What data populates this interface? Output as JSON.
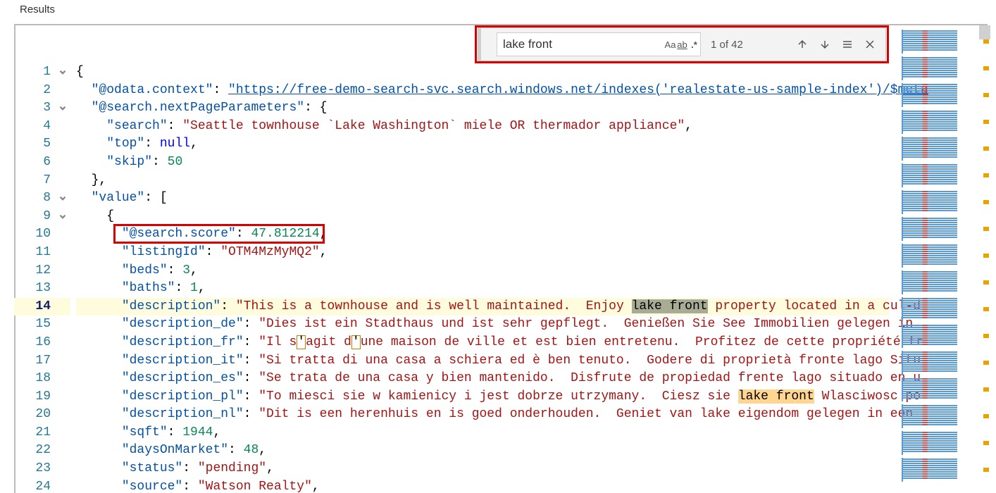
{
  "header": {
    "results_label": "Results"
  },
  "find": {
    "value": "lake front",
    "opt_case": "Aa",
    "opt_word": "ab",
    "opt_regex": ".*",
    "count": "1 of 42"
  },
  "lines": [
    {
      "n": 1,
      "fold": true,
      "indent": 0,
      "segs": [
        {
          "t": "punc",
          "v": "{"
        }
      ]
    },
    {
      "n": 2,
      "indent": 1,
      "segs": [
        {
          "t": "key",
          "v": "\"@odata.context\""
        },
        {
          "t": "punc",
          "v": ": "
        },
        {
          "t": "link",
          "v": "\"https://free-demo-search-svc.search.windows.net/indexes('realestate-us-sample-index')/$meta"
        }
      ]
    },
    {
      "n": 3,
      "fold": true,
      "indent": 1,
      "segs": [
        {
          "t": "key",
          "v": "\"@search.nextPageParameters\""
        },
        {
          "t": "punc",
          "v": ": {"
        }
      ]
    },
    {
      "n": 4,
      "indent": 2,
      "segs": [
        {
          "t": "key",
          "v": "\"search\""
        },
        {
          "t": "punc",
          "v": ": "
        },
        {
          "t": "str",
          "v": "\"Seattle townhouse `Lake Washington` miele OR thermador appliance\""
        },
        {
          "t": "punc",
          "v": ","
        }
      ]
    },
    {
      "n": 5,
      "indent": 2,
      "segs": [
        {
          "t": "key",
          "v": "\"top\""
        },
        {
          "t": "punc",
          "v": ": "
        },
        {
          "t": "null",
          "v": "null"
        },
        {
          "t": "punc",
          "v": ","
        }
      ]
    },
    {
      "n": 6,
      "indent": 2,
      "segs": [
        {
          "t": "key",
          "v": "\"skip\""
        },
        {
          "t": "punc",
          "v": ": "
        },
        {
          "t": "num",
          "v": "50"
        }
      ]
    },
    {
      "n": 7,
      "indent": 1,
      "segs": [
        {
          "t": "punc",
          "v": "},"
        }
      ]
    },
    {
      "n": 8,
      "fold": true,
      "indent": 1,
      "segs": [
        {
          "t": "key",
          "v": "\"value\""
        },
        {
          "t": "punc",
          "v": ": ["
        }
      ]
    },
    {
      "n": 9,
      "fold": true,
      "indent": 2,
      "segs": [
        {
          "t": "punc",
          "v": "{"
        }
      ]
    },
    {
      "n": 10,
      "indent": 3,
      "annot": true,
      "segs": [
        {
          "t": "key",
          "v": "\"@search.score\""
        },
        {
          "t": "punc",
          "v": ": "
        },
        {
          "t": "num",
          "v": "47.812214"
        },
        {
          "t": "punc",
          "v": ","
        }
      ]
    },
    {
      "n": 11,
      "indent": 3,
      "segs": [
        {
          "t": "key",
          "v": "\"listingId\""
        },
        {
          "t": "punc",
          "v": ": "
        },
        {
          "t": "str",
          "v": "\"OTM4MzMyMQ2\""
        },
        {
          "t": "punc",
          "v": ","
        }
      ]
    },
    {
      "n": 12,
      "indent": 3,
      "segs": [
        {
          "t": "key",
          "v": "\"beds\""
        },
        {
          "t": "punc",
          "v": ": "
        },
        {
          "t": "num",
          "v": "3"
        },
        {
          "t": "punc",
          "v": ","
        }
      ]
    },
    {
      "n": 13,
      "indent": 3,
      "segs": [
        {
          "t": "key",
          "v": "\"baths\""
        },
        {
          "t": "punc",
          "v": ": "
        },
        {
          "t": "num",
          "v": "1"
        },
        {
          "t": "punc",
          "v": ","
        }
      ]
    },
    {
      "n": 14,
      "current": true,
      "indent": 3,
      "segs": [
        {
          "t": "key",
          "v": "\"description\""
        },
        {
          "t": "punc",
          "v": ": "
        },
        {
          "t": "str",
          "v": "\"This is a townhouse and is well maintained.  Enjoy "
        },
        {
          "t": "match-sel",
          "v": "lake front"
        },
        {
          "t": "str",
          "v": " property located in a cul-d"
        }
      ]
    },
    {
      "n": 15,
      "indent": 3,
      "segs": [
        {
          "t": "key",
          "v": "\"description_de\""
        },
        {
          "t": "punc",
          "v": ": "
        },
        {
          "t": "str",
          "v": "\"Dies ist ein Stadthaus und ist sehr gepflegt.  Genießen Sie See Immobilien gelegen in "
        }
      ]
    },
    {
      "n": 16,
      "indent": 3,
      "segs": [
        {
          "t": "key",
          "v": "\"description_fr\""
        },
        {
          "t": "punc",
          "v": ": "
        },
        {
          "t": "str",
          "v": "\"Il s"
        },
        {
          "t": "char-hl",
          "v": "'"
        },
        {
          "t": "str",
          "v": "agit d"
        },
        {
          "t": "char-hl",
          "v": "'"
        },
        {
          "t": "str",
          "v": "une maison de ville et est bien entretenu.  Profitez de cette propriété fr"
        }
      ]
    },
    {
      "n": 17,
      "indent": 3,
      "segs": [
        {
          "t": "key",
          "v": "\"description_it\""
        },
        {
          "t": "punc",
          "v": ": "
        },
        {
          "t": "str",
          "v": "\"Si tratta di una casa a schiera ed è ben tenuto.  Godere di proprietà fronte lago Situ"
        }
      ]
    },
    {
      "n": 18,
      "indent": 3,
      "segs": [
        {
          "t": "key",
          "v": "\"description_es\""
        },
        {
          "t": "punc",
          "v": ": "
        },
        {
          "t": "str",
          "v": "\"Se trata de una casa y bien mantenido.  Disfrute de propiedad frente lago situado en u"
        }
      ]
    },
    {
      "n": 19,
      "indent": 3,
      "segs": [
        {
          "t": "key",
          "v": "\"description_pl\""
        },
        {
          "t": "punc",
          "v": ": "
        },
        {
          "t": "str",
          "v": "\"To miesci sie w kamienicy i jest dobrze utrzymany.  Ciesz sie "
        },
        {
          "t": "match-hl",
          "v": "lake front"
        },
        {
          "t": "str",
          "v": " Wlasciwosc po"
        }
      ]
    },
    {
      "n": 20,
      "indent": 3,
      "segs": [
        {
          "t": "key",
          "v": "\"description_nl\""
        },
        {
          "t": "punc",
          "v": ": "
        },
        {
          "t": "str",
          "v": "\"Dit is een herenhuis en is goed onderhouden.  Geniet van lake eigendom gelegen in een "
        }
      ]
    },
    {
      "n": 21,
      "indent": 3,
      "segs": [
        {
          "t": "key",
          "v": "\"sqft\""
        },
        {
          "t": "punc",
          "v": ": "
        },
        {
          "t": "num",
          "v": "1944"
        },
        {
          "t": "punc",
          "v": ","
        }
      ]
    },
    {
      "n": 22,
      "indent": 3,
      "segs": [
        {
          "t": "key",
          "v": "\"daysOnMarket\""
        },
        {
          "t": "punc",
          "v": ": "
        },
        {
          "t": "num",
          "v": "48"
        },
        {
          "t": "punc",
          "v": ","
        }
      ]
    },
    {
      "n": 23,
      "indent": 3,
      "segs": [
        {
          "t": "key",
          "v": "\"status\""
        },
        {
          "t": "punc",
          "v": ": "
        },
        {
          "t": "str",
          "v": "\"pending\""
        },
        {
          "t": "punc",
          "v": ","
        }
      ]
    },
    {
      "n": 24,
      "indent": 3,
      "segs": [
        {
          "t": "key",
          "v": "\"source\""
        },
        {
          "t": "punc",
          "v": ": "
        },
        {
          "t": "str",
          "v": "\"Watson Realty\""
        },
        {
          "t": "punc",
          "v": ","
        }
      ]
    }
  ]
}
